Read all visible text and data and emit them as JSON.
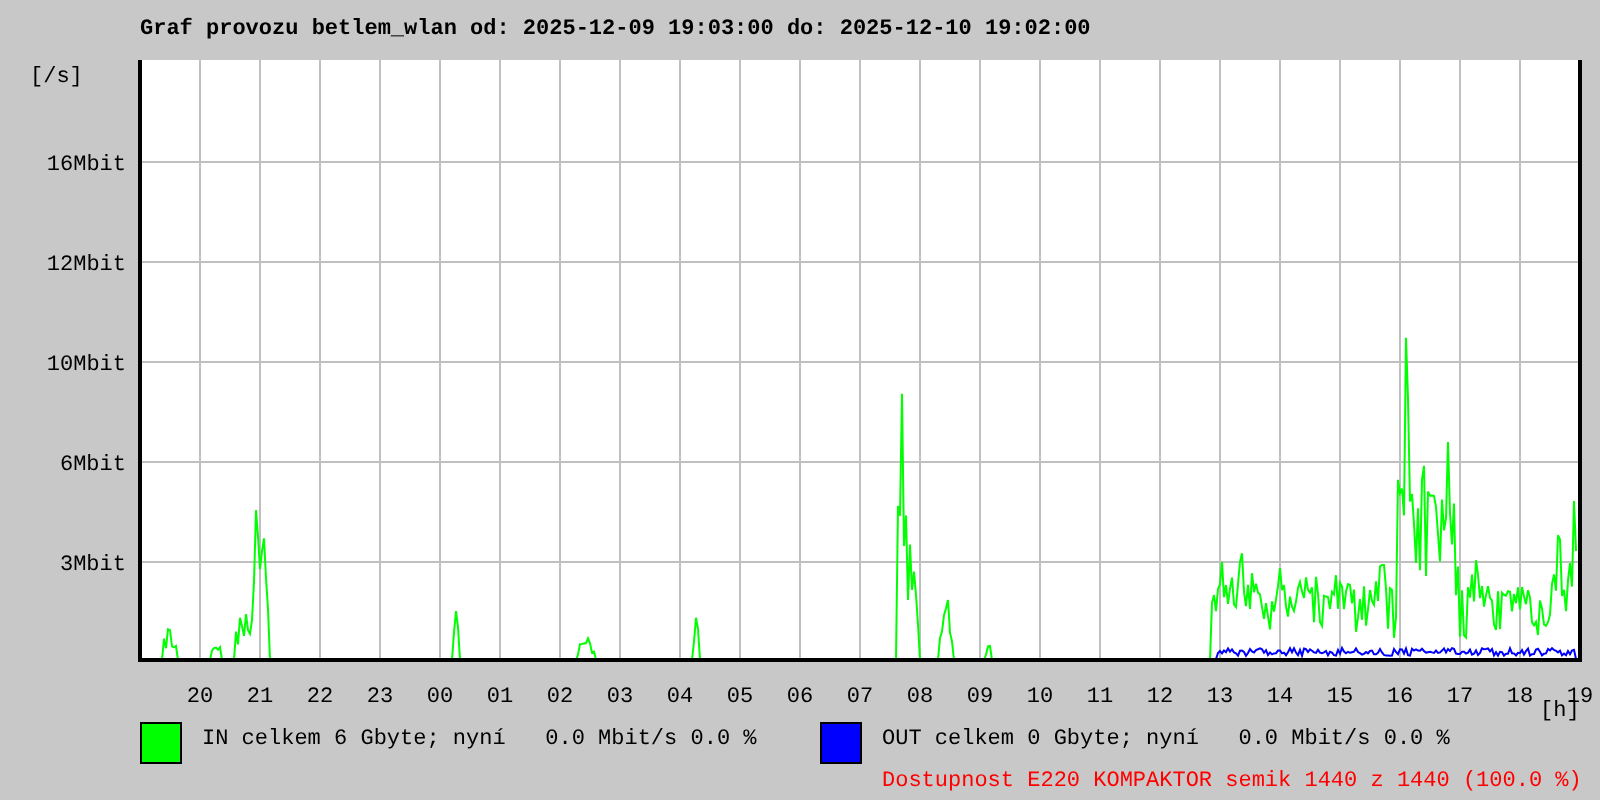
{
  "title": "Graf provozu betlem_wlan od: 2025-12-09 19:03:00 do: 2025-12-10 19:02:00",
  "y_axis": {
    "unit": "[/s]",
    "labels": [
      "16Mbit",
      "12Mbit",
      "10Mbit",
      "6Mbit",
      "3Mbit"
    ]
  },
  "x_axis": {
    "unit": "[h]",
    "labels": [
      "20",
      "21",
      "22",
      "23",
      "00",
      "01",
      "02",
      "03",
      "04",
      "05",
      "06",
      "07",
      "08",
      "09",
      "10",
      "11",
      "12",
      "13",
      "14",
      "15",
      "16",
      "17",
      "18",
      "19"
    ]
  },
  "legend": [
    {
      "kind": "in",
      "label": "IN celkem 6 Gbyte; nyní   0.0 Mbit/s 0.0 %",
      "color": "#00ff00"
    },
    {
      "kind": "out",
      "label": "OUT celkem 0 Gbyte; nyní   0.0 Mbit/s 0.0 %",
      "color": "#0000ff"
    }
  ],
  "availability": "Dostupnost E220 KOMPAKTOR semik 1440 z 1440 (100.0 %)"
}
